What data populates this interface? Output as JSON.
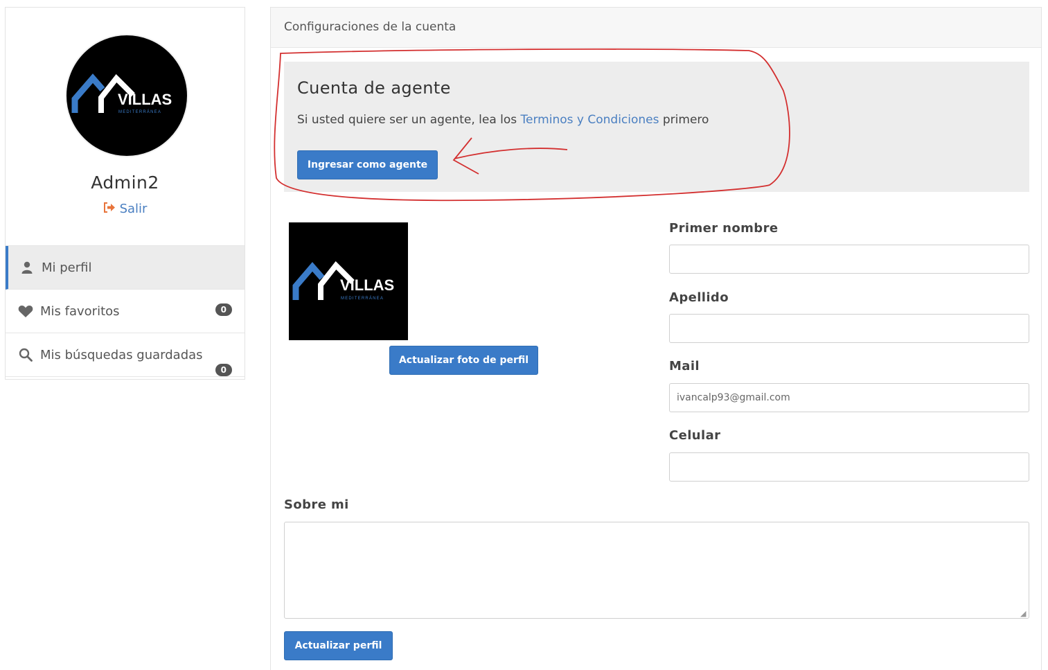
{
  "sidebar": {
    "avatar_logo": {
      "line1": "VILLAS",
      "line2": "MEDITERRÁNEA"
    },
    "username": "Admin2",
    "logout_label": "Salir",
    "items": [
      {
        "label": "Mi perfil",
        "icon": "user-icon",
        "active": true
      },
      {
        "label": "Mis favoritos",
        "icon": "heart-icon",
        "badge": "0"
      },
      {
        "label": "Mis búsquedas guardadas",
        "icon": "search-icon",
        "badge": "0"
      }
    ]
  },
  "main": {
    "header": "Configuraciones de la cuenta",
    "agent": {
      "title": "Cuenta de agente",
      "text_before": "Si usted quiere ser un agente, lea los ",
      "link": "Terminos y Condiciones",
      "text_after": " primero",
      "button": "Ingresar como agente"
    },
    "photo_logo": {
      "line1": "VILLAS",
      "line2": "MEDITERRÁNEA"
    },
    "photo_button": "Actualizar foto de perfil",
    "fields": {
      "first_name": {
        "label": "Primer nombre",
        "value": ""
      },
      "last_name": {
        "label": "Apellido",
        "value": ""
      },
      "mail": {
        "label": "Mail",
        "value": "ivancalp93@gmail.com"
      },
      "phone": {
        "label": "Celular",
        "value": ""
      },
      "about": {
        "label": "Sobre mi",
        "value": ""
      }
    },
    "submit_button": "Actualizar perfil"
  },
  "colors": {
    "primary": "#3a7bc8",
    "link": "#4a7fc1",
    "logout_icon": "#e8743b",
    "annotation": "#d32f2f"
  }
}
